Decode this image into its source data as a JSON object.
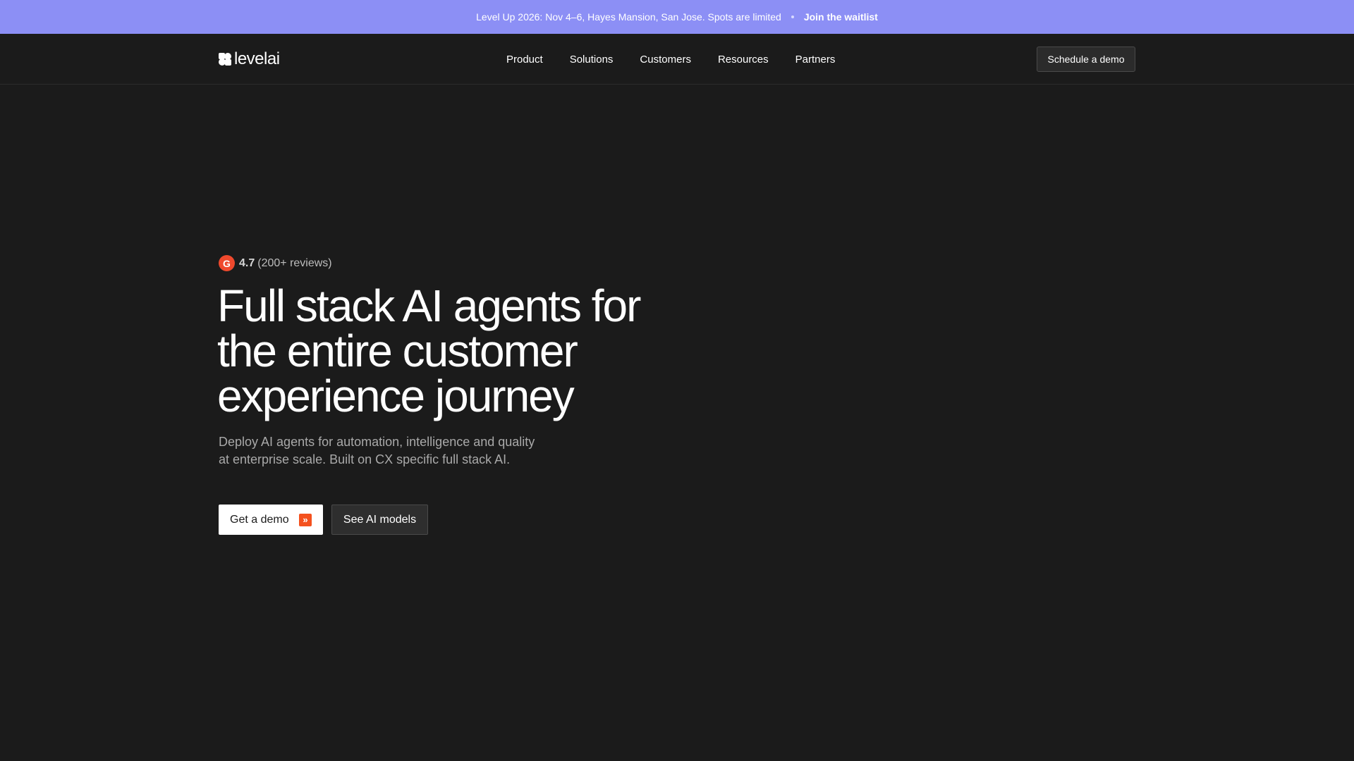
{
  "announcement": {
    "text": "Level Up 2026: Nov 4–6, Hayes Mansion, San Jose. Spots are limited",
    "cta": "Join the waitlist"
  },
  "nav": {
    "logo_text": "levelai",
    "logo_icon": "levelai-logo-icon",
    "links": [
      "Product",
      "Solutions",
      "Customers",
      "Resources",
      "Partners"
    ],
    "schedule_label": "Schedule a demo"
  },
  "hero": {
    "rating": {
      "icon": "g2-icon",
      "icon_glyph": "G",
      "score": "4.7",
      "reviews": "(200+ reviews)"
    },
    "headline_lines": [
      "Full stack AI agents for",
      "the entire customer",
      "experience journey"
    ],
    "subhead_lines": [
      "Deploy AI agents for automation, intelligence and quality",
      "at enterprise scale. Built on CX specific full stack AI."
    ],
    "primary_cta": "Get a demo",
    "primary_cta_icon": "arrow-right-icon",
    "primary_cta_glyph": "»",
    "secondary_cta": "See AI models"
  },
  "colors": {
    "background": "#1b1b1b",
    "announcement_bg": "#8c8ff5",
    "accent": "#f4511e",
    "g2": "#ef492d"
  }
}
